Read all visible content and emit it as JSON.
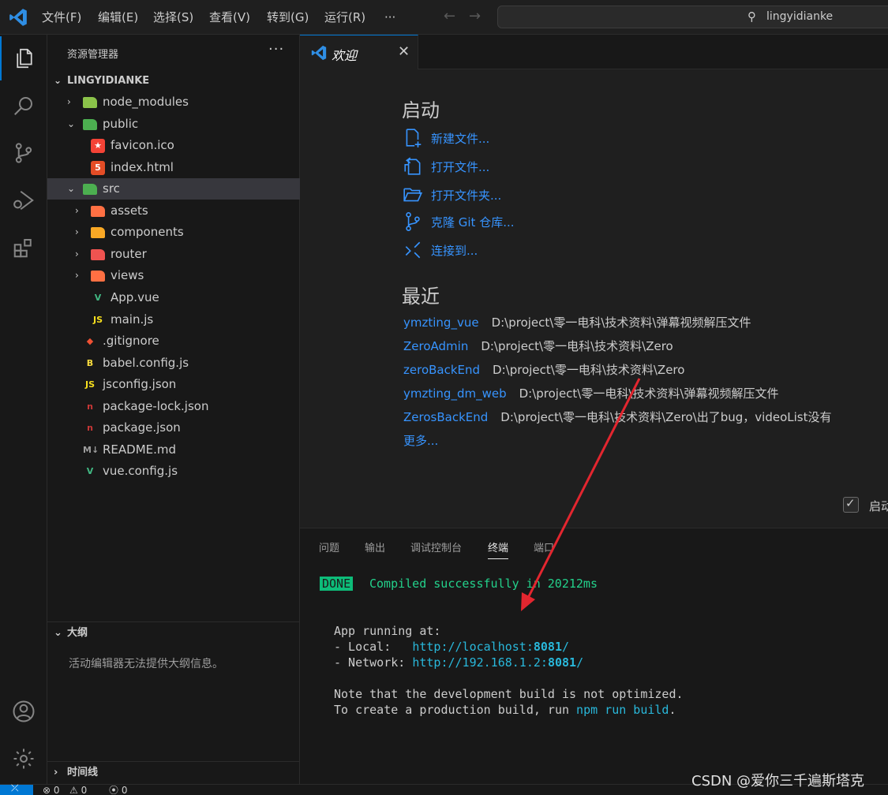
{
  "menu": [
    "文件(F)",
    "编辑(E)",
    "选择(S)",
    "查看(V)",
    "转到(G)",
    "运行(R)",
    "···"
  ],
  "search": {
    "text": "lingyidianke"
  },
  "sidebar": {
    "title": "资源管理器",
    "more": "···",
    "root": "LINGYIDIANKE",
    "items": [
      {
        "label": "node_modules",
        "icon": "node-folder-icon",
        "color": "#8bc34a"
      },
      {
        "label": "public",
        "icon": "public-folder-icon",
        "color": "#4caf50"
      },
      {
        "label": "favicon.ico",
        "icon": "favicon-star-icon",
        "color": "#f44336"
      },
      {
        "label": "index.html",
        "icon": "html5-icon",
        "color": "#e44d26"
      },
      {
        "label": "src",
        "icon": "src-folder-icon",
        "color": "#4caf50"
      },
      {
        "label": "assets",
        "icon": "assets-folder-icon",
        "color": "#ff7043"
      },
      {
        "label": "components",
        "icon": "components-folder-icon",
        "color": "#f9a825"
      },
      {
        "label": "router",
        "icon": "router-folder-icon",
        "color": "#ef5350"
      },
      {
        "label": "views",
        "icon": "views-folder-icon",
        "color": "#ff7043"
      },
      {
        "label": "App.vue",
        "icon": "vue-icon",
        "color": "#41b883"
      },
      {
        "label": "main.js",
        "icon": "js-icon",
        "color": "#f7df1e"
      },
      {
        "label": ".gitignore",
        "icon": "git-icon",
        "color": "#f05133"
      },
      {
        "label": "babel.config.js",
        "icon": "babel-icon",
        "color": "#f9dc3e"
      },
      {
        "label": "jsconfig.json",
        "icon": "js-icon",
        "color": "#f7df1e"
      },
      {
        "label": "package-lock.json",
        "icon": "npm-icon",
        "color": "#cb3837"
      },
      {
        "label": "package.json",
        "icon": "npm-icon",
        "color": "#cb3837"
      },
      {
        "label": "README.md",
        "icon": "markdown-icon",
        "color": "#9e9e9e"
      },
      {
        "label": "vue.config.js",
        "icon": "vue-config-icon",
        "color": "#41b883"
      }
    ],
    "outline_title": "大纲",
    "outline_msg": "活动编辑器无法提供大纲信息。",
    "timeline_title": "时间线"
  },
  "editor": {
    "tab_label": "欢迎",
    "start_title": "启动",
    "start_items": [
      "新建文件...",
      "打开文件...",
      "打开文件夹...",
      "克隆 Git 仓库...",
      "连接到..."
    ],
    "recent_title": "最近",
    "recent": [
      {
        "name": "ymzting_vue",
        "path": "D:\\project\\零一电科\\技术资料\\弹幕视频解压文件"
      },
      {
        "name": "ZeroAdmin",
        "path": "D:\\project\\零一电科\\技术资料\\Zero"
      },
      {
        "name": "zeroBackEnd",
        "path": "D:\\project\\零一电科\\技术资料\\Zero"
      },
      {
        "name": "ymzting_dm_web",
        "path": "D:\\project\\零一电科\\技术资料\\弹幕视频解压文件"
      },
      {
        "name": "ZerosBackEnd",
        "path": "D:\\project\\零一电科\\技术资料\\Zero\\出了bug，videoList没有"
      }
    ],
    "more": "更多...",
    "startup_label": "启动"
  },
  "panel": {
    "tabs": [
      "问题",
      "输出",
      "调试控制台",
      "终端",
      "端口"
    ],
    "done_badge": "DONE",
    "compiled": "Compiled successfully in 20212ms",
    "app_running": "App running at:",
    "local_label": "- Local:   ",
    "local_url_pre": "http://localhost:",
    "local_port": "8081",
    "url_slash": "/",
    "network_label": "- Network: ",
    "network_url_pre": "http://192.168.1.2:",
    "network_port": "8081",
    "note1": "Note that the development build is not optimized.",
    "note2_pre": "To create a production build, run ",
    "note2_cmd": "npm run build",
    "note2_post": "."
  },
  "status": {
    "errors": "0",
    "warnings": "0",
    "ports": "0"
  },
  "watermark": "CSDN @爱你三千遍斯塔克",
  "colors": {
    "accent": "#0078d4",
    "link": "#3794ff",
    "arrow": "#e3262f",
    "done_bg": "#0dbc79"
  }
}
